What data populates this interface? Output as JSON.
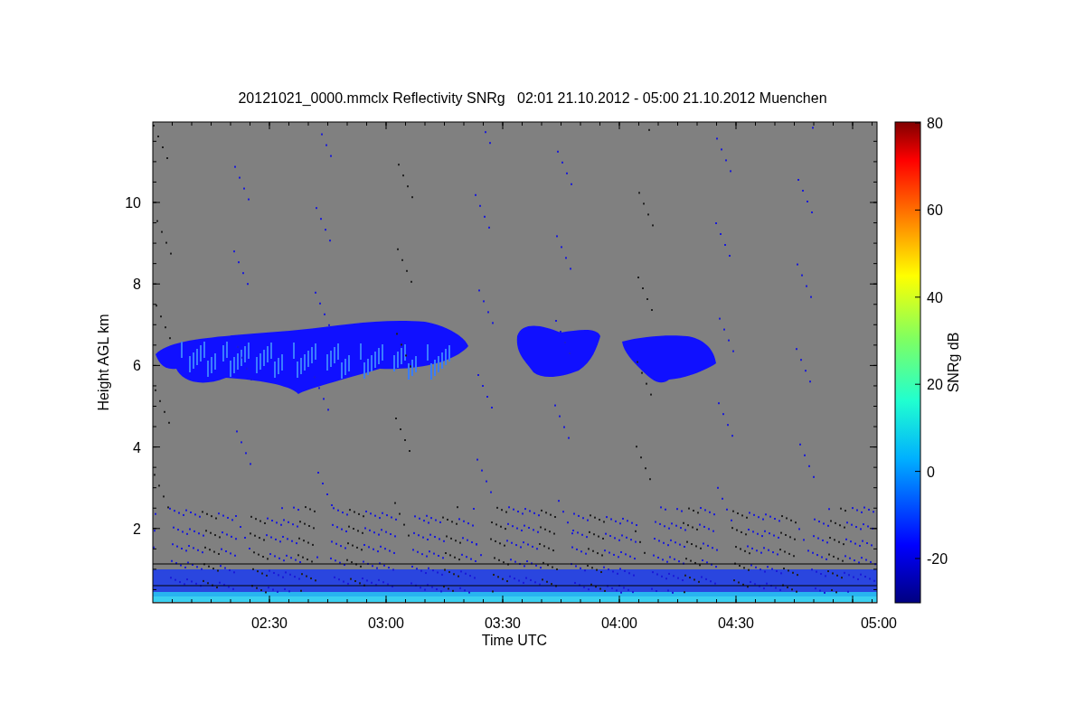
{
  "chart": {
    "title": "20121021_0000.mmclx Reflectivity SNRg   02:01 21.10.2012 - 05:00 21.10.2012 Muenchen",
    "ylabel": "Height AGL km",
    "xlabel": "Time UTC",
    "yticks": [
      "10",
      "8",
      "6",
      "4",
      "2"
    ],
    "xticks": [
      "02:30",
      "03:00",
      "03:30",
      "04:00",
      "04:30",
      "05:00"
    ]
  },
  "colorbar": {
    "label": "SNRg dB",
    "ticks": [
      "80",
      "60",
      "40",
      "20",
      "0",
      "-20"
    ]
  }
}
